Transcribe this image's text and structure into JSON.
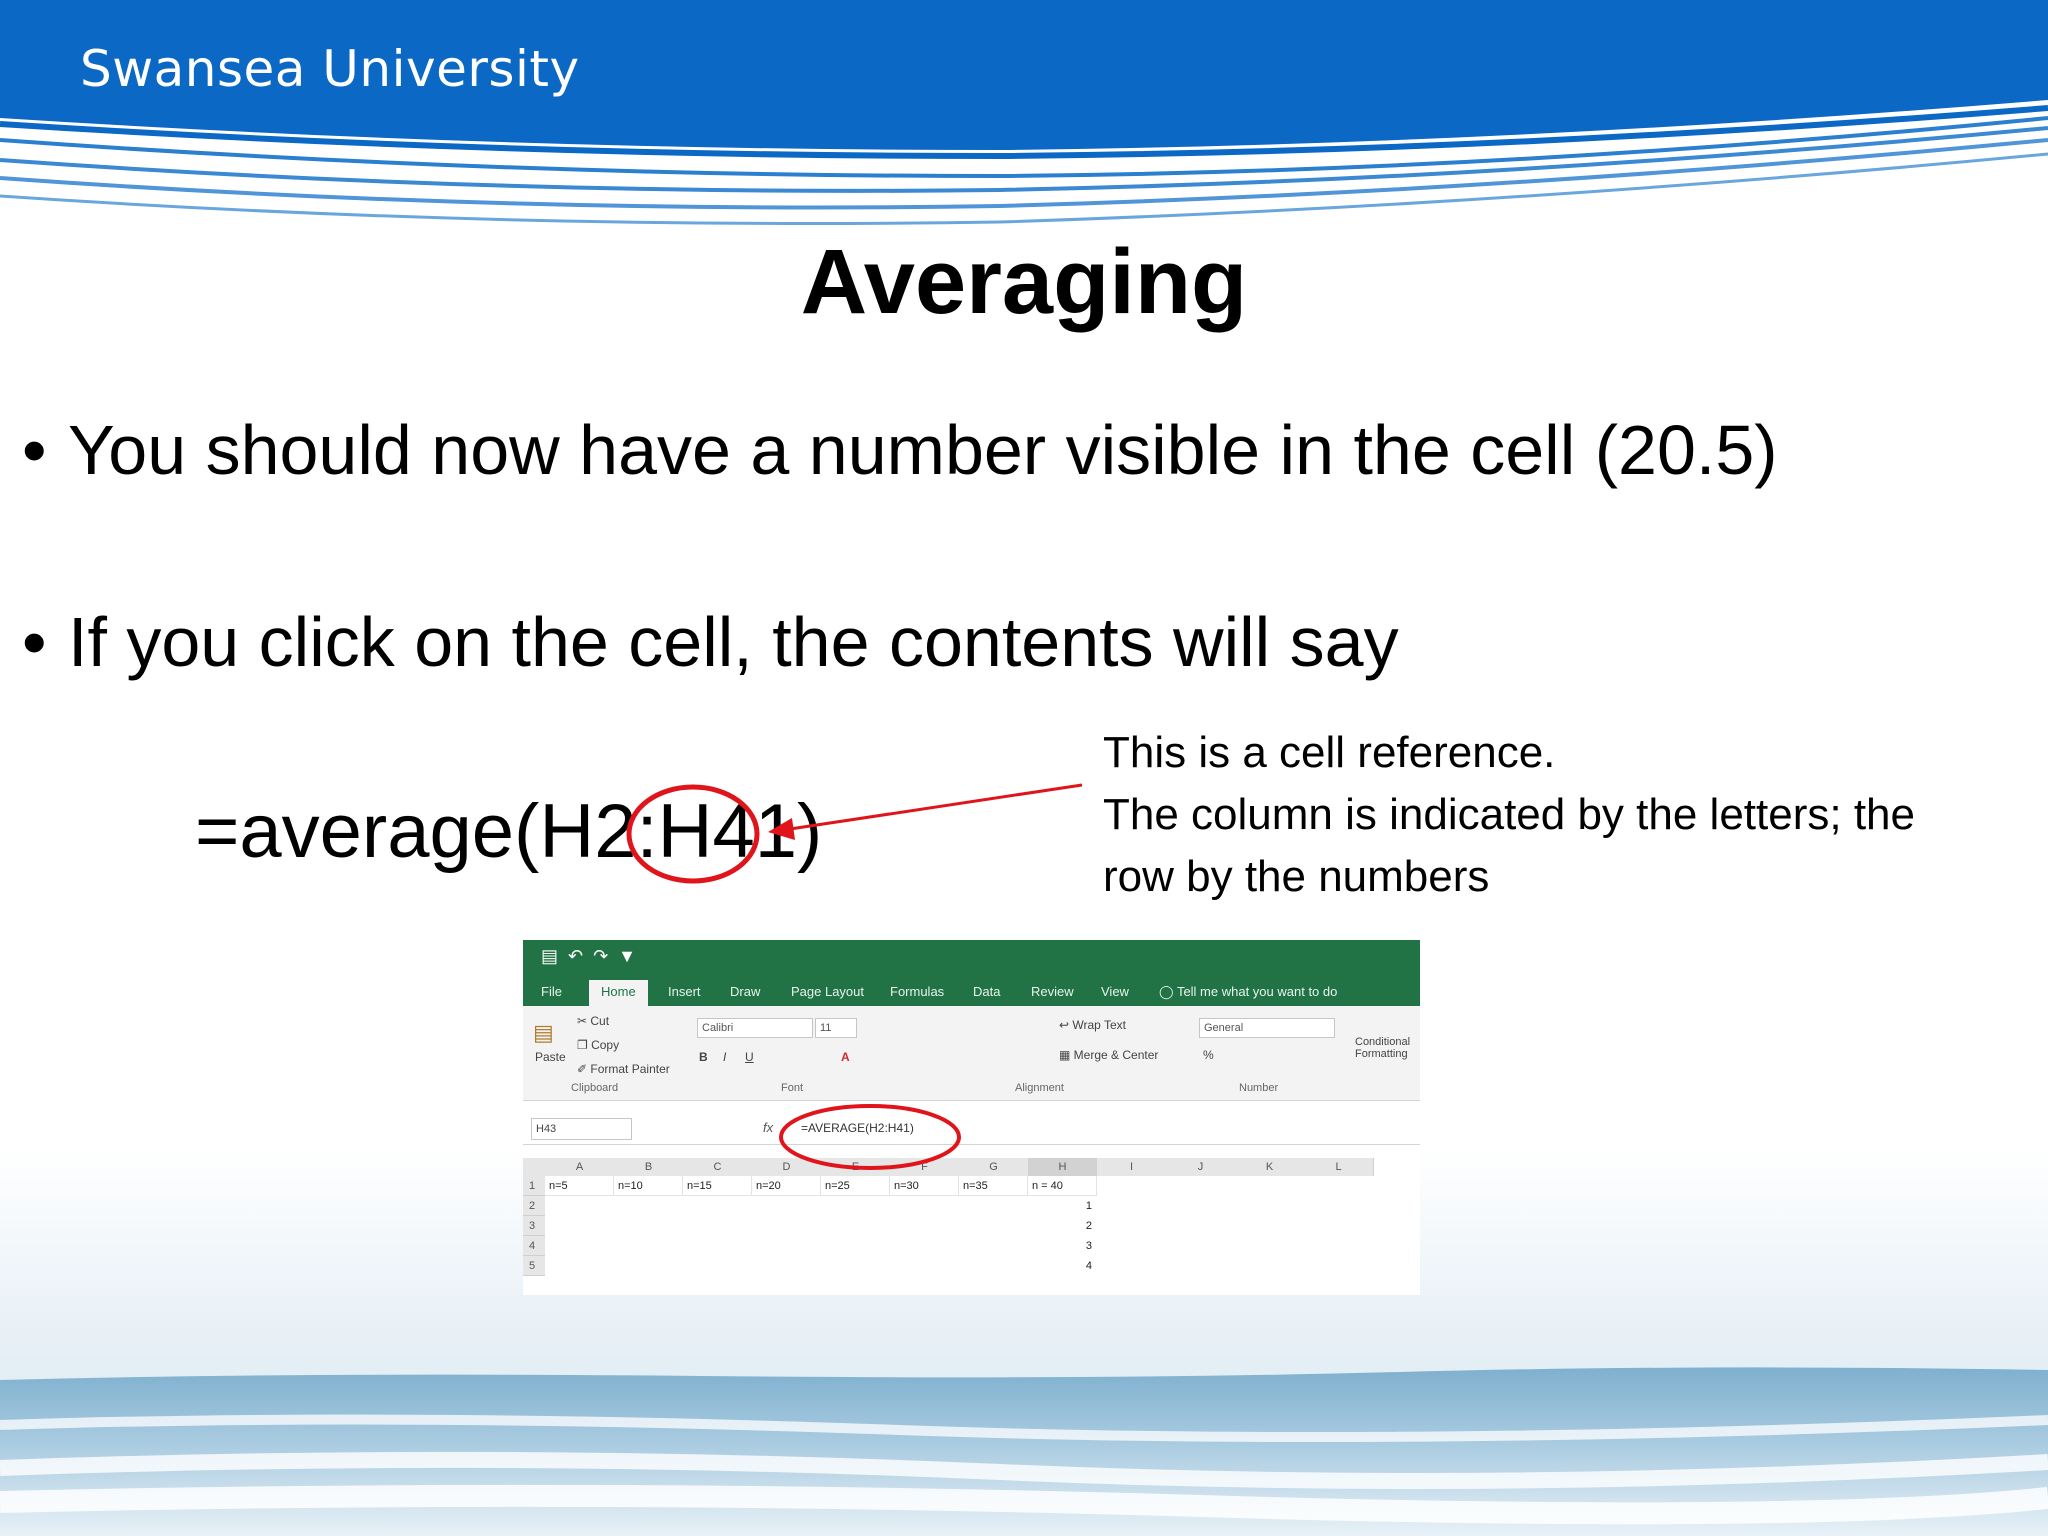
{
  "header": {
    "brand": "Swansea University"
  },
  "slide": {
    "title": "Averaging",
    "bullets": [
      "You should now have a number visible in the cell (20.5)",
      "If you click on the cell, the contents will say"
    ],
    "formula": "=average(H2:H41)",
    "annotation": [
      "This is a cell reference.",
      "The column is indicated by the letters; the",
      "row by the numbers"
    ]
  },
  "excel": {
    "tabs": [
      "File",
      "Home",
      "Insert",
      "Draw",
      "Page Layout",
      "Formulas",
      "Data",
      "Review",
      "View"
    ],
    "tell_me": "Tell me what you want to do",
    "clipboard": {
      "paste": "Paste",
      "cut": "Cut",
      "copy": "Copy",
      "format_painter": "Format Painter",
      "group": "Clipboard"
    },
    "font": {
      "name": "Calibri",
      "size": "11",
      "group": "Font"
    },
    "alignment": {
      "wrap": "Wrap Text",
      "merge": "Merge & Center",
      "group": "Alignment"
    },
    "number": {
      "format": "General",
      "group": "Number"
    },
    "styles": {
      "conditional_1": "Conditional",
      "conditional_2": "Formatting"
    },
    "name_box": "H43",
    "formula_bar": "=AVERAGE(H2:H41)",
    "columns": [
      "A",
      "B",
      "C",
      "D",
      "E",
      "F",
      "G",
      "H",
      "I",
      "J",
      "K",
      "L"
    ],
    "rows": [
      "1",
      "2",
      "3",
      "4",
      "5"
    ],
    "row1": [
      "n=5",
      "n=10",
      "n=15",
      "n=20",
      "n=25",
      "n=30",
      "n=35",
      "n = 40"
    ],
    "h_values": [
      "1",
      "2",
      "3",
      "4"
    ]
  },
  "colors": {
    "banner_blue": "#0b68c4",
    "highlight_red": "#e0141b",
    "excel_green": "#217346"
  }
}
